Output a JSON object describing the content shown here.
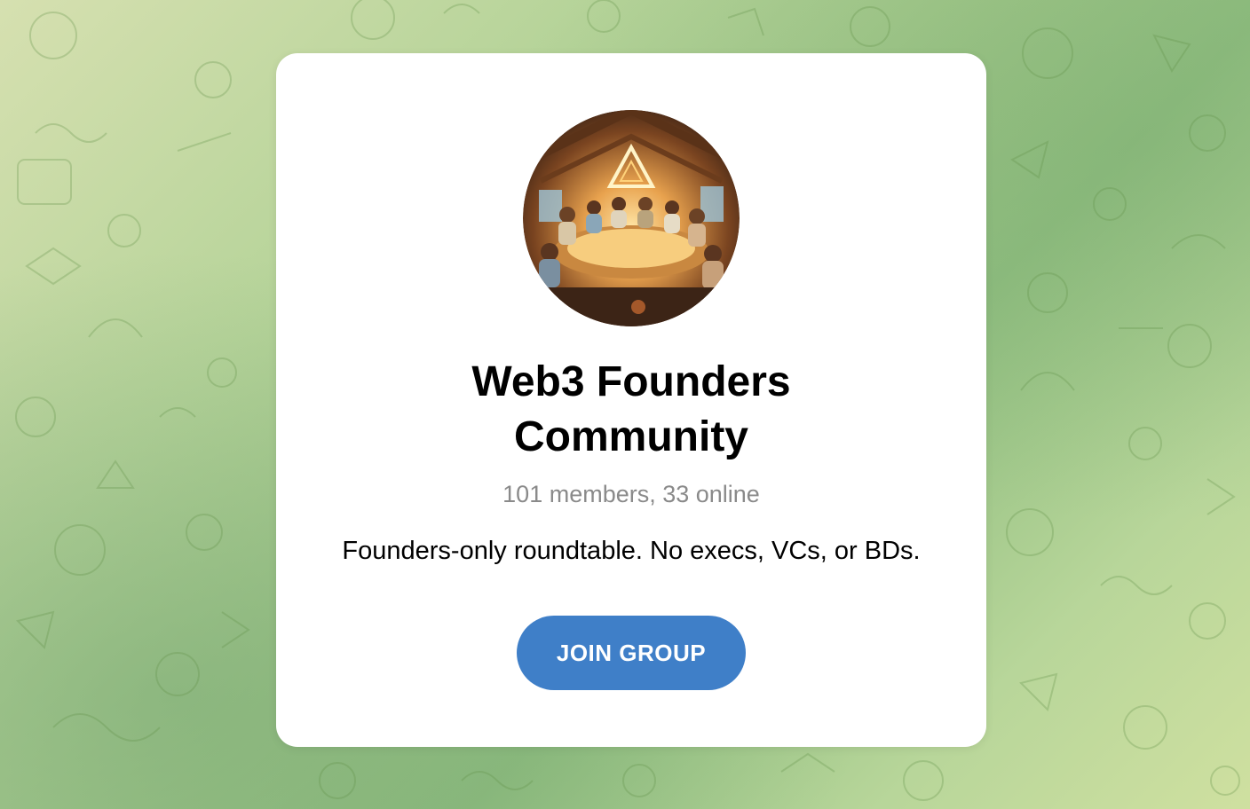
{
  "group": {
    "title": "Web3 Founders Community",
    "members_line": "101 members, 33 online",
    "description": "Founders-only roundtable. No execs, VCs, or BDs."
  },
  "actions": {
    "join_label": "JOIN GROUP"
  },
  "colors": {
    "button": "#3f7fc8",
    "card": "#ffffff",
    "subtitle": "#8a8a8a"
  },
  "icons": {
    "avatar": "group-avatar-illustration",
    "background": "doodle-pattern"
  }
}
